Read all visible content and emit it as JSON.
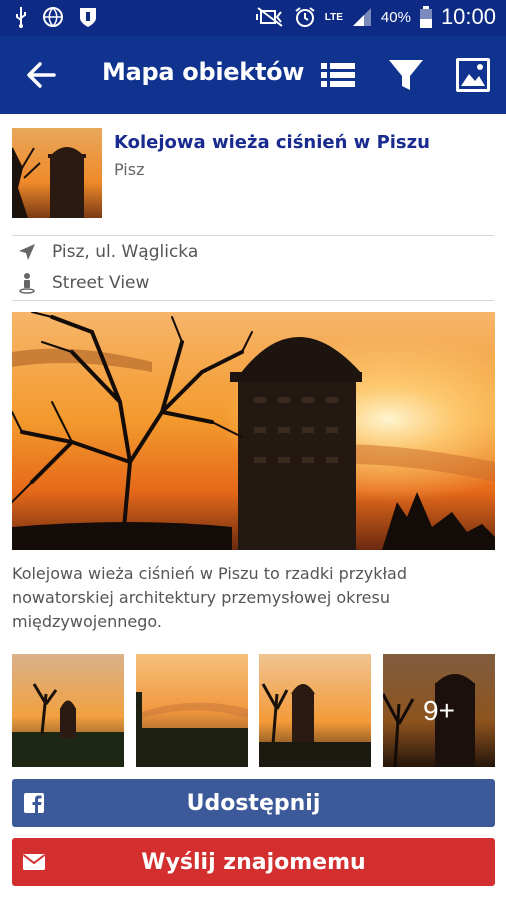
{
  "status_bar": {
    "network": "LTE",
    "battery": "40%",
    "time": "10:00"
  },
  "app_bar": {
    "title": "Mapa obiektów",
    "icons": [
      "back-arrow-icon",
      "list-icon",
      "filter-icon",
      "gallery-icon"
    ]
  },
  "place": {
    "title": "Kolejowa wieża ciśnień w Piszu",
    "city": "Pisz",
    "address": "Pisz, ul. Wąglicka",
    "street_view_label": "Street View",
    "description": "Kolejowa wieża ciśnień w Piszu to rzadki przykład nowatorskiej architektury przemysłowej okresu międzywojennego."
  },
  "gallery": {
    "more_label": "9+"
  },
  "actions": {
    "share_label": "Udostępnij",
    "send_label": "Wyślij znajomemu"
  },
  "colors": {
    "status_bar": "#0d2a85",
    "app_bar": "#10338f",
    "title_text": "#1a2b8f",
    "share_button": "#3c5a9a",
    "send_button": "#d32f2f"
  }
}
